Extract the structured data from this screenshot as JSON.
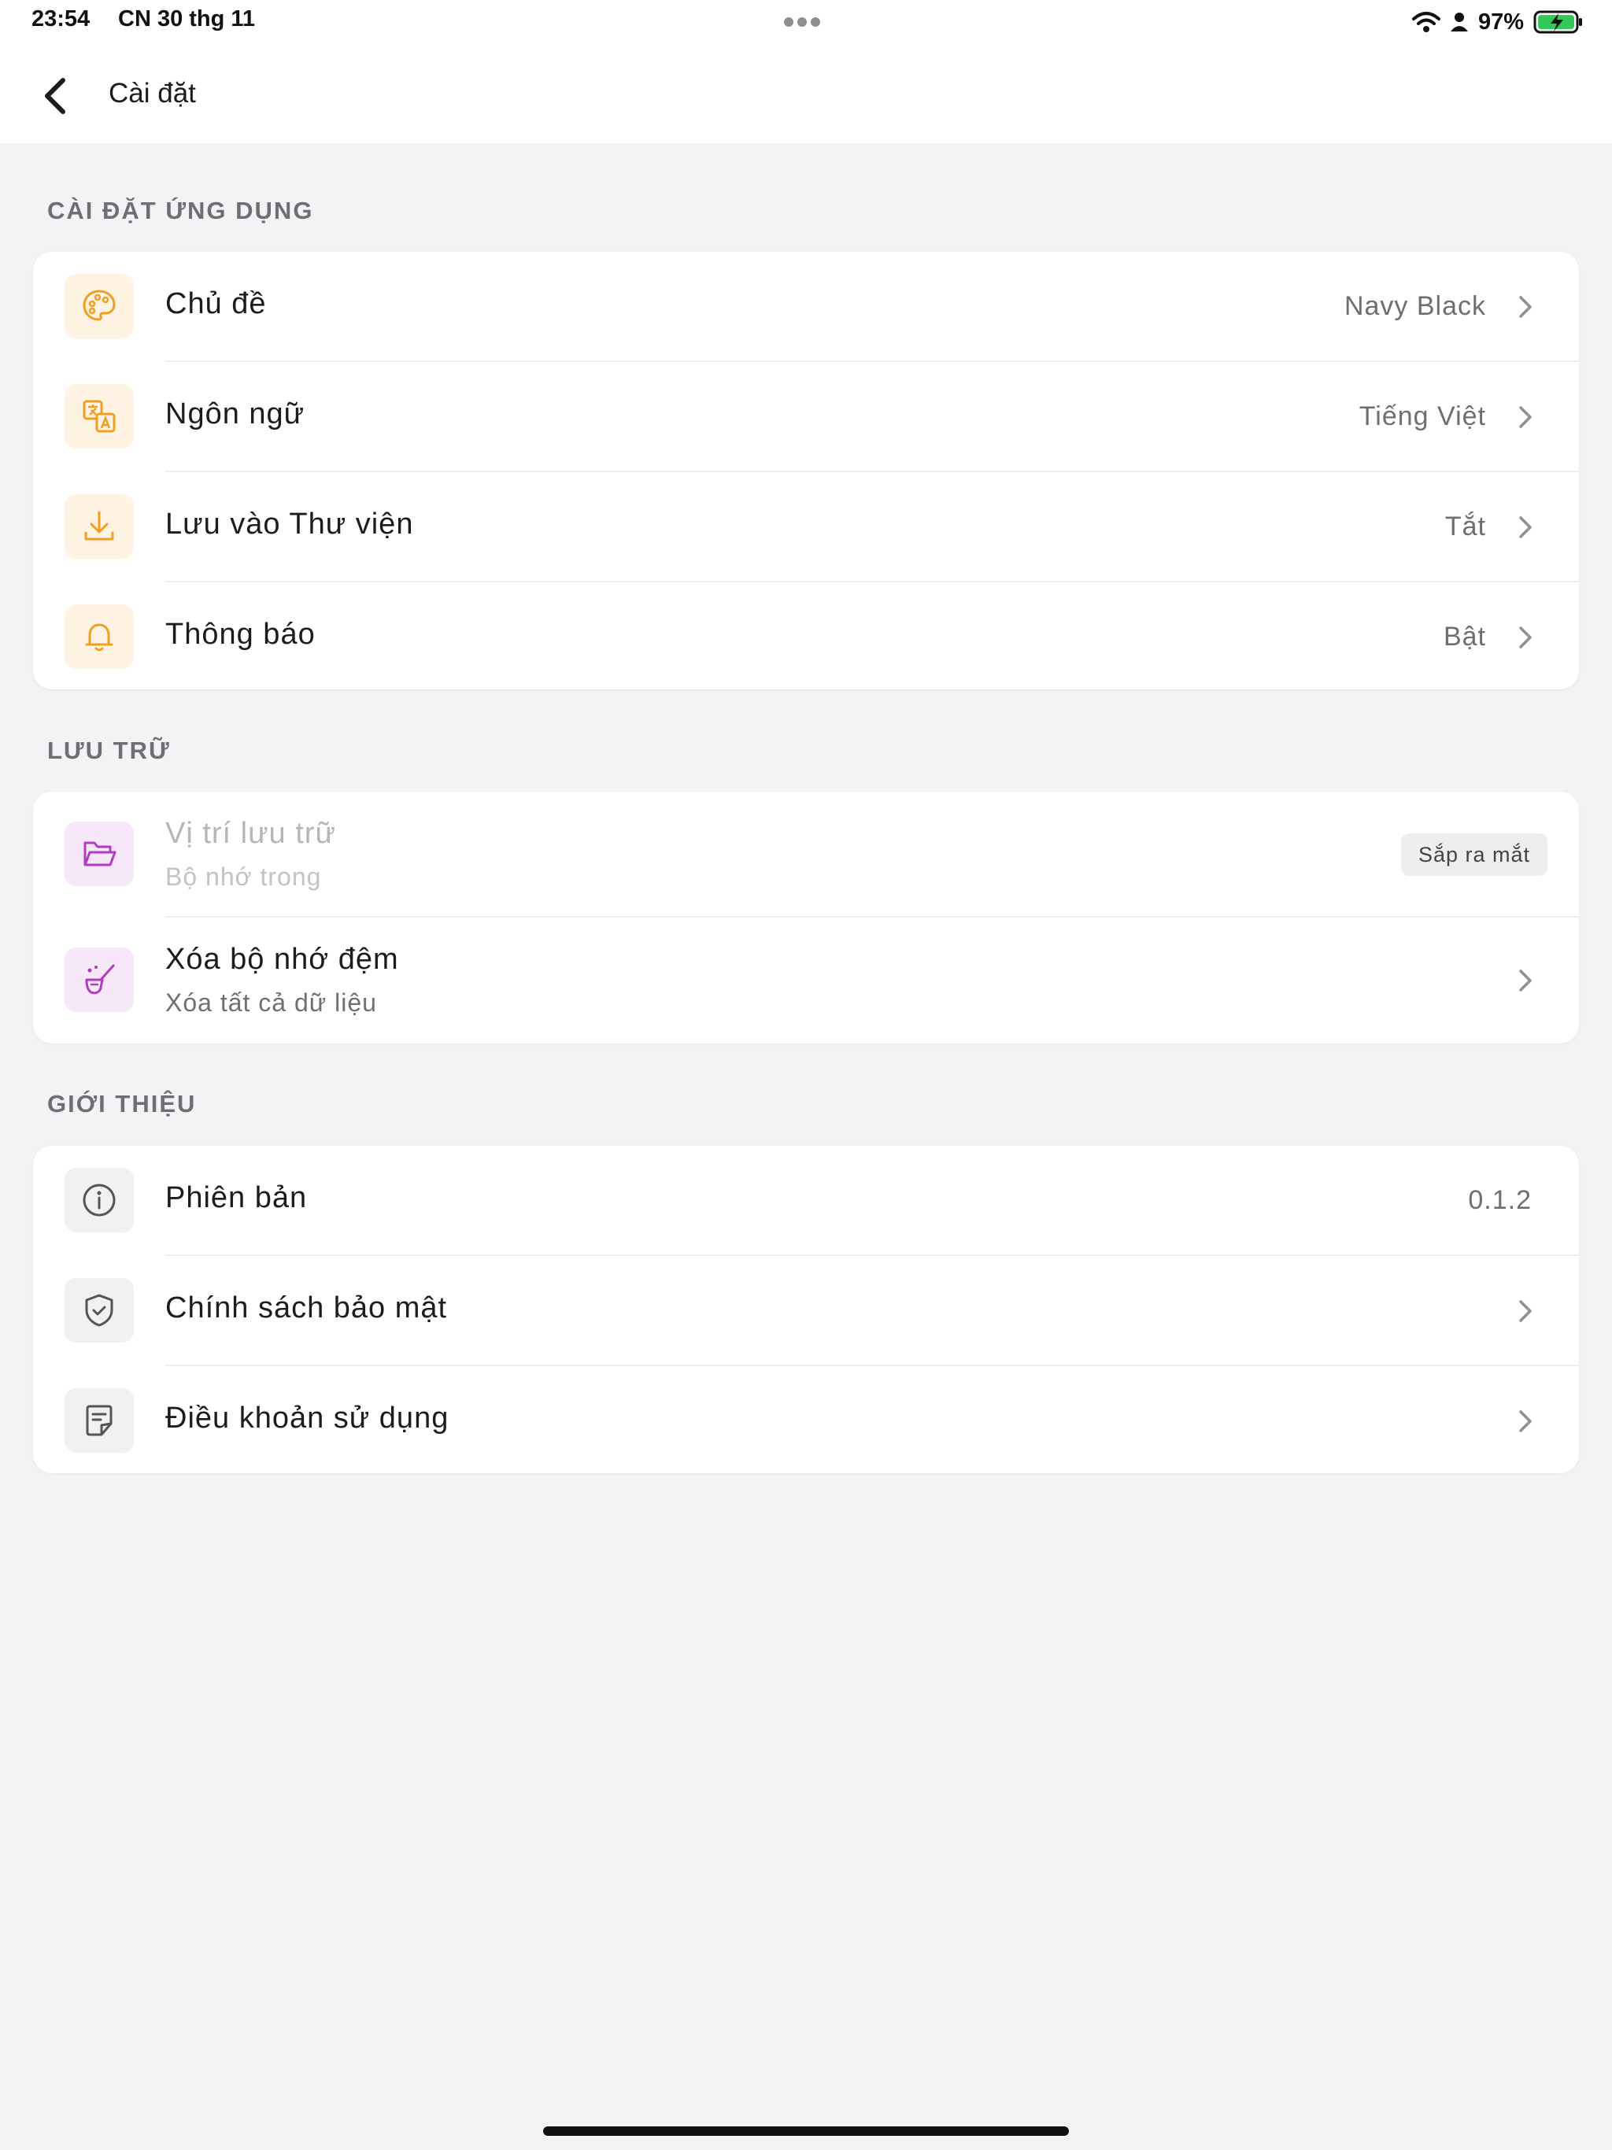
{
  "status_bar": {
    "time": "23:54",
    "date": "CN 30 thg 11",
    "battery": "97%",
    "icons": [
      "more-dots-icon",
      "wifi-icon",
      "person-icon",
      "battery-charging-icon"
    ]
  },
  "nav": {
    "title": "Cài đặt",
    "back_icon": "chevron-left-icon"
  },
  "sections": {
    "app": {
      "header": "CÀI ĐẶT ỨNG DỤNG",
      "items": [
        {
          "title": "Chủ đề",
          "value": "Navy Black",
          "icon": "palette-icon"
        },
        {
          "title": "Ngôn ngữ",
          "value": "Tiếng Việt",
          "icon": "translate-icon"
        },
        {
          "title": "Lưu vào Thư viện",
          "value": "Tắt",
          "icon": "download-icon"
        },
        {
          "title": "Thông báo",
          "value": "Bật",
          "icon": "bell-icon"
        }
      ]
    },
    "storage": {
      "header": "LƯU TRỮ",
      "items": [
        {
          "title": "Vị trí lưu trữ",
          "subtitle": "Bộ nhớ trong",
          "badge": "Sắp ra mắt",
          "icon": "folder-open-icon"
        },
        {
          "title": "Xóa bộ nhớ đệm",
          "subtitle": "Xóa tất cả dữ liệu",
          "icon": "broom-icon"
        }
      ]
    },
    "about": {
      "header": "GIỚI THIỆU",
      "items": [
        {
          "title": "Phiên bản",
          "value": "0.1.2",
          "icon": "info-icon"
        },
        {
          "title": "Chính sách bảo mật",
          "icon": "shield-check-icon"
        },
        {
          "title": "Điều khoản sử dụng",
          "icon": "document-icon"
        }
      ]
    }
  },
  "colors": {
    "background": "#f2f3f5",
    "card": "#ffffff",
    "orange_icon": "#f0a020",
    "purple_icon": "#b03cc0",
    "gray_icon": "#555555"
  }
}
